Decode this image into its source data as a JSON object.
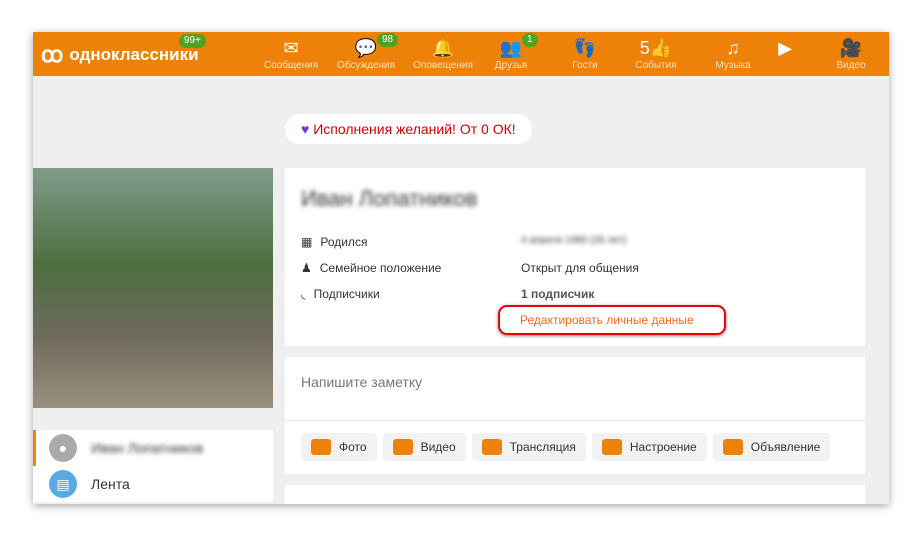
{
  "header": {
    "logo": "одноклассники",
    "logo_badge": "99+",
    "nav": [
      {
        "label": "Сообщения",
        "icon": "envelope-icon",
        "glyph": "✉",
        "badge": ""
      },
      {
        "label": "Обсуждения",
        "icon": "chat-icon",
        "glyph": "💬",
        "badge": "98"
      },
      {
        "label": "Оповещения",
        "icon": "bell-icon",
        "glyph": "🔔",
        "badge": ""
      },
      {
        "label": "Друзья",
        "icon": "friends-icon",
        "glyph": "👥",
        "badge": "1"
      },
      {
        "label": "Гости",
        "icon": "footprints-icon",
        "glyph": "👣",
        "badge": ""
      },
      {
        "label": "События",
        "icon": "events-icon",
        "glyph": "5👍",
        "badge": ""
      },
      {
        "label": "Музыка",
        "icon": "music-icon",
        "glyph": "♫",
        "badge": ""
      },
      {
        "label": "",
        "icon": "play-icon",
        "glyph": "▶",
        "badge": ""
      },
      {
        "label": "Видео",
        "icon": "video-camera-icon",
        "glyph": "🎥",
        "badge": ""
      }
    ]
  },
  "promo": "Исполнения желаний! От 0 ОК!",
  "profile": {
    "name": "Иван Лопатников",
    "rows": [
      {
        "label": "Родился",
        "value": "4 апреля 1990 (26 лет)"
      },
      {
        "label": "Семейное положение",
        "value": "Открыт для общения"
      },
      {
        "label": "Подписчики",
        "value": "1 подписчик"
      }
    ],
    "edit_link": "Редактировать личные данные"
  },
  "note": {
    "placeholder": "Напишите заметку",
    "buttons": [
      "Фото",
      "Видео",
      "Трансляция",
      "Настроение",
      "Объявление"
    ]
  },
  "left_menu": [
    {
      "label": "Иван Лопатников"
    },
    {
      "label": "Лента"
    }
  ]
}
